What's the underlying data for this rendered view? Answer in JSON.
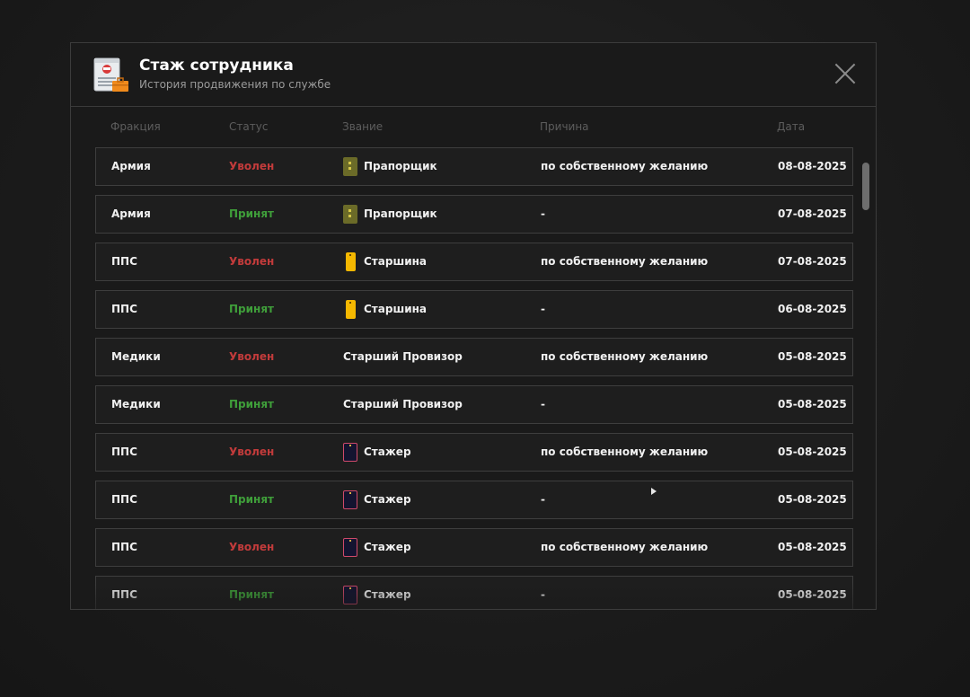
{
  "header": {
    "title": "Стаж сотрудника",
    "subtitle": "История продвижения по службе"
  },
  "columns": {
    "faction": "Фракция",
    "status": "Статус",
    "rank": "Звание",
    "reason": "Причина",
    "date": "Дата"
  },
  "colors": {
    "fired": "#c23b3b",
    "hired": "#3f9e3a"
  },
  "rows": [
    {
      "faction": "Армия",
      "status": "Уволен",
      "status_type": "fired",
      "rank_icon": "olive-shoulder-strap-icon",
      "rank": "Прапорщик",
      "reason": "по собственному желанию",
      "date": "08-08-2025"
    },
    {
      "faction": "Армия",
      "status": "Принят",
      "status_type": "hired",
      "rank_icon": "olive-shoulder-strap-icon",
      "rank": "Прапорщик",
      "reason": "-",
      "date": "07-08-2025"
    },
    {
      "faction": "ППС",
      "status": "Уволен",
      "status_type": "fired",
      "rank_icon": "yellow-shoulder-strap-icon",
      "rank": "Старшина",
      "reason": "по собственному желанию",
      "date": "07-08-2025"
    },
    {
      "faction": "ППС",
      "status": "Принят",
      "status_type": "hired",
      "rank_icon": "yellow-shoulder-strap-icon",
      "rank": "Старшина",
      "reason": "-",
      "date": "06-08-2025"
    },
    {
      "faction": "Медики",
      "status": "Уволен",
      "status_type": "fired",
      "rank_icon": "",
      "rank": "Старший Провизор",
      "reason": "по собственному желанию",
      "date": "05-08-2025"
    },
    {
      "faction": "Медики",
      "status": "Принят",
      "status_type": "hired",
      "rank_icon": "",
      "rank": "Старший Провизор",
      "reason": "-",
      "date": "05-08-2025"
    },
    {
      "faction": "ППС",
      "status": "Уволен",
      "status_type": "fired",
      "rank_icon": "navy-shoulder-strap-icon",
      "rank": "Стажер",
      "reason": "по собственному желанию",
      "date": "05-08-2025"
    },
    {
      "faction": "ППС",
      "status": "Принят",
      "status_type": "hired",
      "rank_icon": "navy-shoulder-strap-icon",
      "rank": "Стажер",
      "reason": "-",
      "date": "05-08-2025"
    },
    {
      "faction": "ППС",
      "status": "Уволен",
      "status_type": "fired",
      "rank_icon": "navy-shoulder-strap-icon",
      "rank": "Стажер",
      "reason": "по собственному желанию",
      "date": "05-08-2025"
    },
    {
      "faction": "ППС",
      "status": "Принят",
      "status_type": "hired",
      "rank_icon": "navy-shoulder-strap-icon",
      "rank": "Стажер",
      "reason": "-",
      "date": "05-08-2025"
    }
  ]
}
